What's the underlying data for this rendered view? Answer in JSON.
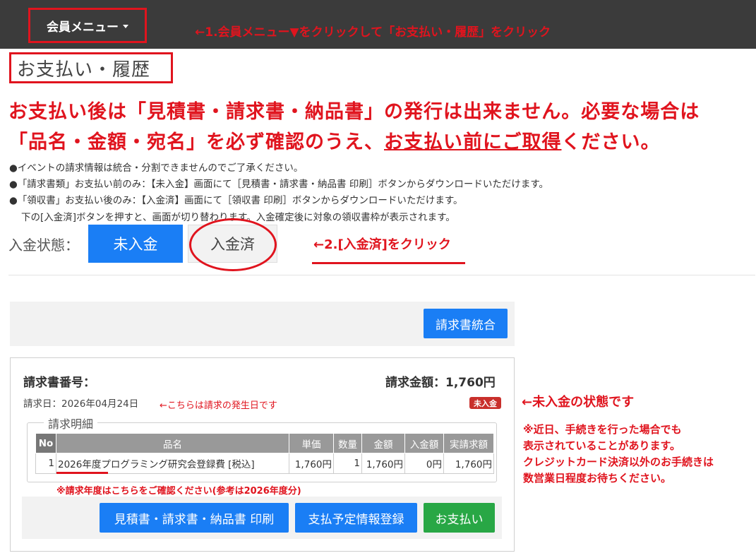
{
  "header": {
    "member_menu_label": "会員メニュー",
    "annotation1": "←1.会員メニュー▼をクリックして「お支払い・履歴」をクリック"
  },
  "page_title": "お支払い・履歴",
  "warning": {
    "line1": "お支払い後は「見積書・請求書・納品書」の発行は出来ません。必要な場合は",
    "line2_prefix": "「品名・金額・宛名」を必ず確認のうえ、",
    "line2_underlined": "お支払い前にご取得",
    "line2_suffix": "ください。"
  },
  "notes": [
    "●イベントの請求情報は統合・分割できませんのでご了承ください。",
    "●「請求書類」お支払い前のみ：【未入金】画面にて［見積書・請求書・納品書 印刷］ボタンからダウンロードいただけます。",
    "●「領収書」お支払い後のみ：【入金済】画面にて［領収書 印刷］ボタンからダウンロードいただけます。",
    "下の[入金済]ボタンを押すと、画面が切り替わります。入金確定後に対象の領収書枠が表示されます。"
  ],
  "status": {
    "label": "入金状態：",
    "unpaid_button": "未入金",
    "paid_button": "入金済",
    "annotation2": "←2.[入金済]をクリック"
  },
  "merge_button": "請求書統合",
  "invoice": {
    "number_label": "請求書番号：",
    "amount_text": "請求金額：1,760円",
    "date_text": "請求日：2026年04月24日",
    "date_annotation": "←こちらは請求の発生日です",
    "badge": "未入金",
    "details_legend": "請求明細",
    "columns": [
      "No",
      "品名",
      "単価",
      "数量",
      "金額",
      "入金額",
      "実請求額"
    ],
    "rows": [
      {
        "no": "1",
        "name": "2026年度プログラミング研究会登録費 [税込]",
        "unit_price": "1,760円",
        "qty": "1",
        "amount": "1,760円",
        "paid": "0円",
        "actual": "1,760円"
      }
    ],
    "year_annotation": "※請求年度はこちらをご確認ください(参考は2026年度分)",
    "buttons": {
      "print": "見積書・請求書・納品書 印刷",
      "schedule": "支払予定情報登録",
      "pay": "お支払い"
    }
  },
  "side_annotations": {
    "status_note": "←未入金の状態です",
    "lines": [
      "※近日、手続きを行った場合でも",
      "表示されていることがあります。",
      "クレジットカード決済以外のお手続きは",
      "数営業日程度お待ちください。"
    ]
  },
  "colors": {
    "topbar": "#3b3b3b",
    "annotation_red": "#e0141e",
    "primary_blue": "#1a7ef5",
    "success_green": "#28a745",
    "badge_red": "#c9302c"
  }
}
